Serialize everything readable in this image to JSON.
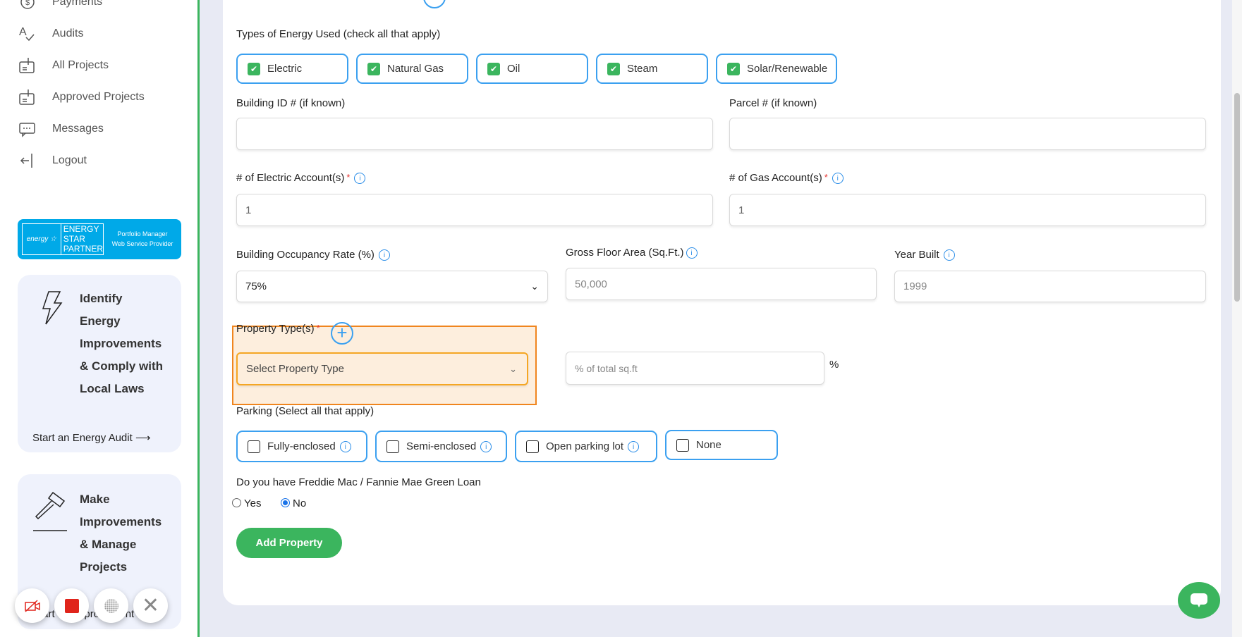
{
  "sidebar": {
    "items": [
      {
        "label": "Payments",
        "icon": "payments-icon"
      },
      {
        "label": "Audits",
        "icon": "audits-icon"
      },
      {
        "label": "All Projects",
        "icon": "projects-icon"
      },
      {
        "label": "Approved Projects",
        "icon": "approved-projects-icon"
      },
      {
        "label": "Messages",
        "icon": "messages-icon"
      },
      {
        "label": "Logout",
        "icon": "logout-icon"
      }
    ],
    "badge": {
      "logo_text": "energy",
      "l1": "ENERGY",
      "l2": "STAR",
      "l3": "PARTNER",
      "sub1": "Portfolio Manager",
      "sub2": "Web Service Provider"
    },
    "card1": {
      "lines": [
        "Identify",
        "Energy",
        "Improvements",
        "& Comply with",
        "Local Laws"
      ],
      "link": "Start an Energy Audit"
    },
    "card2": {
      "lines": [
        "Make",
        "Improvements",
        "& Manage",
        "Projects"
      ],
      "link": "Start an Improvement"
    }
  },
  "form": {
    "energy_label": "Types of Energy Used (check all that apply)",
    "energy_types": [
      {
        "label": "Electric",
        "checked": true
      },
      {
        "label": "Natural Gas",
        "checked": true
      },
      {
        "label": "Oil",
        "checked": true
      },
      {
        "label": "Steam",
        "checked": true
      },
      {
        "label": "Solar/Renewable",
        "checked": true
      }
    ],
    "building_id_label": "Building ID # (if known)",
    "building_id_value": "",
    "parcel_label": "Parcel # (if known)",
    "parcel_value": "",
    "electric_accounts_label": "# of Electric Account(s)",
    "electric_accounts_value": "1",
    "gas_accounts_label": "# of Gas Account(s)",
    "gas_accounts_value": "1",
    "required_mark": "*",
    "occupancy_label": "Building Occupancy Rate (%)",
    "occupancy_value": "75%",
    "floor_area_label": "Gross Floor Area (Sq.Ft.)",
    "floor_area_placeholder": "50,000",
    "year_built_label": "Year Built",
    "year_built_placeholder": "1999",
    "property_type_label": "Property Type(s)",
    "property_type_placeholder": "Select Property Type",
    "pct_placeholder": "% of total sq.ft",
    "pct_unit": "%",
    "parking_label": "Parking (Select all that apply)",
    "parking": [
      {
        "label": "Fully-enclosed",
        "checked": false,
        "info": true
      },
      {
        "label": "Semi-enclosed",
        "checked": false,
        "info": true
      },
      {
        "label": "Open parking lot",
        "checked": false,
        "info": true
      },
      {
        "label": "None",
        "checked": false,
        "info": false
      }
    ],
    "green_loan_label": "Do you have Freddie Mac / Fannie Mae Green Loan",
    "green_loan_options": [
      {
        "label": "Yes",
        "selected": false
      },
      {
        "label": "No",
        "selected": true
      }
    ],
    "submit_label": "Add Property"
  },
  "colors": {
    "accent_green": "#3bb55e",
    "accent_blue": "#3ba0f0",
    "highlight": "#f0851e"
  }
}
